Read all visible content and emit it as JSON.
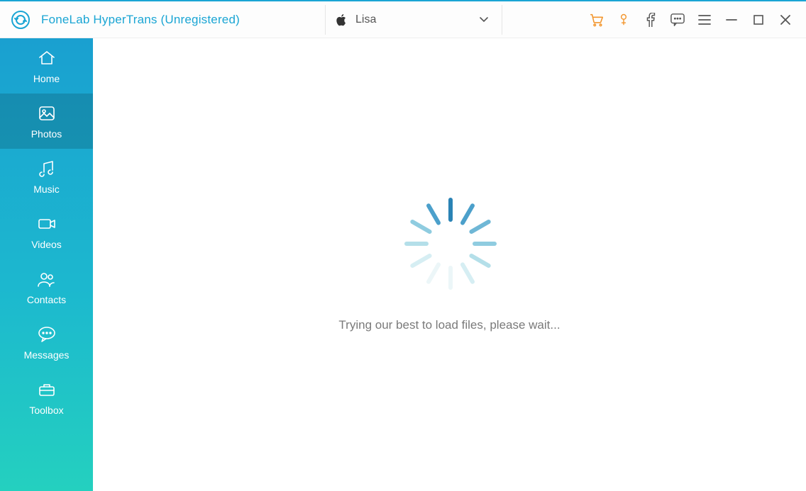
{
  "app": {
    "title": "FoneLab HyperTrans (Unregistered)"
  },
  "device": {
    "name": "Lisa"
  },
  "sidebar": {
    "items": [
      {
        "id": "home",
        "label": "Home"
      },
      {
        "id": "photos",
        "label": "Photos"
      },
      {
        "id": "music",
        "label": "Music"
      },
      {
        "id": "videos",
        "label": "Videos"
      },
      {
        "id": "contacts",
        "label": "Contacts"
      },
      {
        "id": "messages",
        "label": "Messages"
      },
      {
        "id": "toolbox",
        "label": "Toolbox"
      }
    ],
    "active": "photos"
  },
  "main": {
    "loading_text": "Trying our best to load files, please wait..."
  },
  "spinner_colors": [
    "#2a83b5",
    "#4ca0cb",
    "#6fb7d6",
    "#8fcce0",
    "#b4dfe9",
    "#d6eef3",
    "#ecf6f8",
    "#ecf6f8",
    "#d6eef3",
    "#b4dfe9",
    "#8fcce0",
    "#4ca0cb"
  ]
}
